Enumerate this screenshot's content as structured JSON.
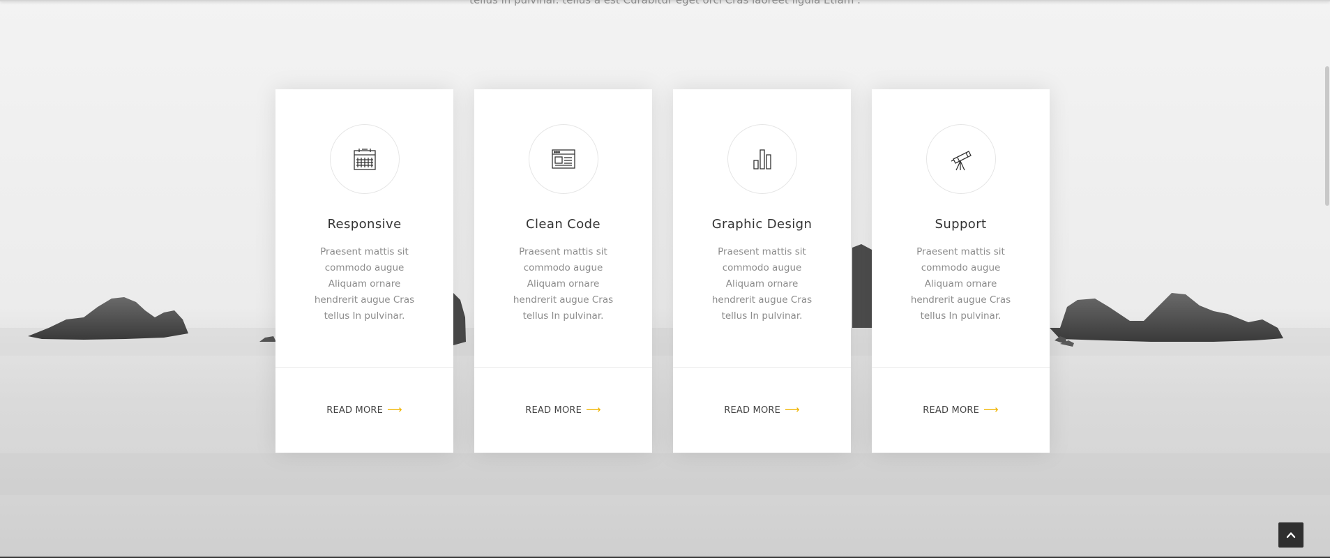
{
  "intro": {
    "text": "tellus in pulvinar. tellus a est Curabitur eget orci Cras laoreet ligula Etiam ."
  },
  "features": [
    {
      "icon": "calendar-icon",
      "title": "Responsive",
      "text": "Praesent mattis sit commodo augue Aliquam ornare hendrerit augue Cras tellus In pulvinar.",
      "link": "READ MORE",
      "arrow": "⟶"
    },
    {
      "icon": "browser-window-icon",
      "title": "Clean Code",
      "text": "Praesent mattis sit commodo augue Aliquam ornare hendrerit augue Cras tellus In pulvinar.",
      "link": "READ MORE",
      "arrow": "⟶"
    },
    {
      "icon": "bar-chart-icon",
      "title": "Graphic Design",
      "text": "Praesent mattis sit commodo augue Aliquam ornare hendrerit augue Cras tellus In pulvinar.",
      "link": "READ MORE",
      "arrow": "⟶"
    },
    {
      "icon": "telescope-icon",
      "title": "Support",
      "text": "Praesent mattis sit commodo augue Aliquam ornare hendrerit augue Cras tellus In pulvinar.",
      "link": "READ MORE",
      "arrow": "⟶"
    }
  ],
  "back_to_top": {
    "icon": "chevron-up-icon"
  },
  "colors": {
    "accent": "#f0b400",
    "card_bg": "#ffffff",
    "title": "#333333",
    "body_text": "#8c8c8c",
    "back_to_top_bg": "#2f2f2f"
  }
}
